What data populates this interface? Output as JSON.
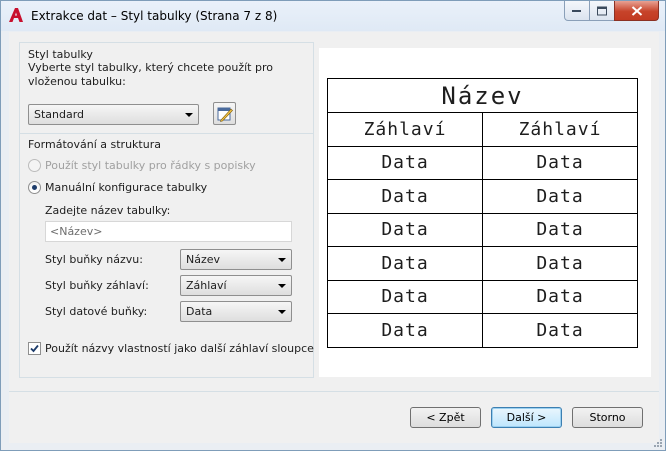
{
  "window": {
    "title": "Extrakce dat – Styl tabulky (Strana 7 z 8)",
    "icon": "autocad-a-icon",
    "accent_color": "#c23a22"
  },
  "table_style_group": {
    "title": "Styl tabulky",
    "description": "Vyberte styl tabulky, který chcete použít pro vloženou tabulku:",
    "selected_style": "Standard",
    "edit_icon": "table-style-edit-icon"
  },
  "formatting_group": {
    "title": "Formátování a struktura",
    "radio_use_style": "Použít styl tabulky pro řádky s popisky",
    "radio_manual": "Manuální konfigurace tabulky",
    "name_label": "Zadejte název tabulky:",
    "name_placeholder": "<Název>",
    "title_cell_label": "Styl buňky názvu:",
    "title_cell_value": "Název",
    "header_cell_label": "Styl buňky záhlaví:",
    "header_cell_value": "Záhlaví",
    "data_cell_label": "Styl datové buňky:",
    "data_cell_value": "Data",
    "use_property_names": "Použít názvy vlastností jako další záhlaví sloupce"
  },
  "preview": {
    "title": "Název",
    "headers": [
      "Záhlaví",
      "Záhlaví"
    ],
    "rows": [
      [
        "Data",
        "Data"
      ],
      [
        "Data",
        "Data"
      ],
      [
        "Data",
        "Data"
      ],
      [
        "Data",
        "Data"
      ],
      [
        "Data",
        "Data"
      ],
      [
        "Data",
        "Data"
      ]
    ]
  },
  "buttons": {
    "back": "< Zpět",
    "next": "Další >",
    "cancel": "Storno"
  }
}
